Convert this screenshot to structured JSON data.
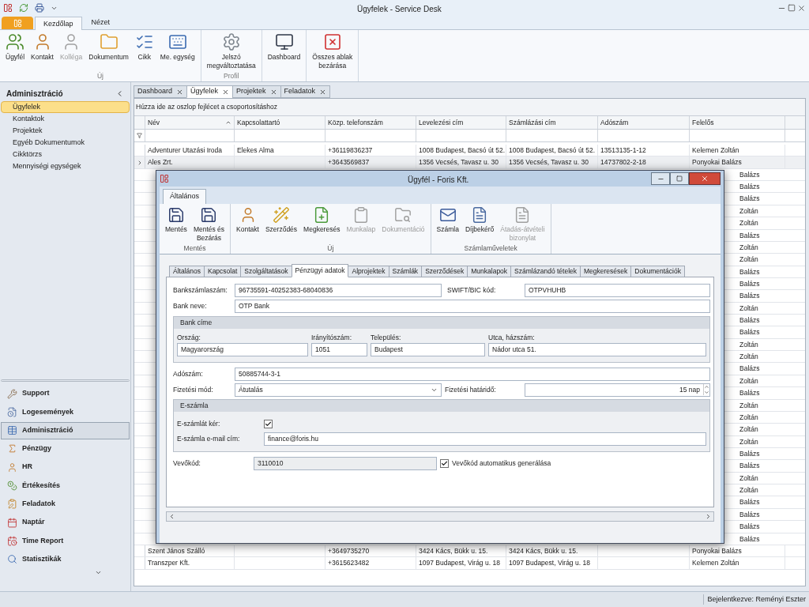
{
  "window": {
    "title": "Ügyfelek - Service Desk"
  },
  "ribbon": {
    "tabs": [
      {
        "label": "Kezdőlap",
        "selected": true
      },
      {
        "label": "Nézet",
        "selected": false
      }
    ],
    "groups": [
      {
        "label": "Új",
        "buttons": [
          {
            "label": "Ügyfél",
            "disabled": false
          },
          {
            "label": "Kontakt",
            "disabled": false
          },
          {
            "label": "Kolléga",
            "disabled": true
          },
          {
            "label": "Dokumentum",
            "disabled": false
          },
          {
            "label": "Cikk",
            "disabled": false
          },
          {
            "label": "Me. egység",
            "disabled": false
          }
        ]
      },
      {
        "label": "Profil",
        "buttons": [
          {
            "label": "Jelszó\nmegváltoztatása",
            "disabled": false
          }
        ]
      },
      {
        "buttons": [
          {
            "label": "Dashboard",
            "disabled": false
          }
        ]
      },
      {
        "buttons": [
          {
            "label": "Összes ablak\nbezárása",
            "disabled": false
          }
        ]
      }
    ]
  },
  "sidebar": {
    "title": "Adminisztráció",
    "items": [
      {
        "label": "Ügyfelek",
        "selected": true
      },
      {
        "label": "Kontaktok",
        "selected": false
      },
      {
        "label": "Projektek",
        "selected": false
      },
      {
        "label": "Egyéb Dokumentumok",
        "selected": false
      },
      {
        "label": "Cikktörzs",
        "selected": false
      },
      {
        "label": "Mennyiségi egységek",
        "selected": false
      }
    ],
    "nav": [
      {
        "label": "Support",
        "selected": false
      },
      {
        "label": "Logesemények",
        "selected": false
      },
      {
        "label": "Adminisztráció",
        "selected": true
      },
      {
        "label": "Pénzügy",
        "selected": false
      },
      {
        "label": "HR",
        "selected": false
      },
      {
        "label": "Értékesítés",
        "selected": false
      },
      {
        "label": "Feladatok",
        "selected": false
      },
      {
        "label": "Naptár",
        "selected": false
      },
      {
        "label": "Time Report",
        "selected": false
      },
      {
        "label": "Statisztikák",
        "selected": false
      }
    ]
  },
  "doc_tabs": [
    {
      "label": "Dashboard",
      "selected": false
    },
    {
      "label": "Ügyfelek",
      "selected": true
    },
    {
      "label": "Projektek",
      "selected": false
    },
    {
      "label": "Feladatok",
      "selected": false
    }
  ],
  "group_panel": "Húzza ide az oszlop fejlécet a csoportosításhoz",
  "table": {
    "columns": [
      "Név",
      "Kapcsolattartó",
      "Közp. telefonszám",
      "Levelezési cím",
      "Számlázási cím",
      "Adószám",
      "Felelős"
    ],
    "rows": [
      {
        "kind": "full",
        "current": false,
        "cells": [
          "Adventurer Utazási Iroda",
          "Elekes Alma",
          "+36119836237",
          "1008 Budapest, Bacsó út 52.",
          "1008 Budapest, Bacsó út 52.",
          "13513135-1-12",
          "Kelemen Zoltán"
        ]
      },
      {
        "kind": "full",
        "current": true,
        "cells": [
          "Ales Zrt.",
          "",
          "+3643569837",
          "1356 Vecsés, Tavasz u. 30",
          "1356 Vecsés, Tavasz u. 30",
          "14737802-2-18",
          "Ponyokai Balázs"
        ]
      },
      {
        "kind": "covered",
        "tail": "Balázs"
      },
      {
        "kind": "covered",
        "tail": "Balázs"
      },
      {
        "kind": "covered",
        "tail": "Balázs"
      },
      {
        "kind": "covered",
        "tail": "Zoltán"
      },
      {
        "kind": "covered",
        "tail": "Zoltán"
      },
      {
        "kind": "covered",
        "tail": "Balázs"
      },
      {
        "kind": "covered",
        "tail": "Zoltán"
      },
      {
        "kind": "covered",
        "tail": "Zoltán"
      },
      {
        "kind": "covered",
        "tail": "Balázs"
      },
      {
        "kind": "covered",
        "tail": "Balázs"
      },
      {
        "kind": "covered",
        "tail": "Balázs"
      },
      {
        "kind": "covered",
        "tail": "Zoltán"
      },
      {
        "kind": "covered",
        "tail": "Balázs"
      },
      {
        "kind": "covered",
        "tail": "Balázs"
      },
      {
        "kind": "covered",
        "tail": "Zoltán"
      },
      {
        "kind": "covered",
        "tail": "Zoltán"
      },
      {
        "kind": "covered",
        "tail": "Balázs"
      },
      {
        "kind": "covered",
        "tail": "Zoltán"
      },
      {
        "kind": "covered",
        "tail": "Balázs"
      },
      {
        "kind": "covered",
        "tail": "Zoltán"
      },
      {
        "kind": "covered",
        "tail": "Zoltán"
      },
      {
        "kind": "covered",
        "tail": "Zoltán"
      },
      {
        "kind": "covered",
        "tail": "Zoltán"
      },
      {
        "kind": "covered",
        "tail": "Balázs"
      },
      {
        "kind": "covered",
        "tail": "Balázs"
      },
      {
        "kind": "covered",
        "tail": "Zoltán"
      },
      {
        "kind": "covered",
        "tail": "Zoltán"
      },
      {
        "kind": "covered",
        "tail": "Balázs"
      },
      {
        "kind": "covered",
        "tail": "Balázs"
      },
      {
        "kind": "covered",
        "tail": "Balázs"
      },
      {
        "kind": "covered",
        "tail": "Balázs"
      },
      {
        "kind": "full",
        "current": false,
        "cells": [
          "Szent János Szálló",
          "",
          "+3649735270",
          "3424 Kács, Bükk u. 15.",
          "3424 Kács, Bükk u. 15.",
          "",
          "Ponyokai Balázs"
        ]
      },
      {
        "kind": "full",
        "current": false,
        "cells": [
          "Transzper Kft.",
          "",
          "+3615623482",
          "1097 Budapest, Virág u. 18",
          "1097 Budapest, Virág u. 18",
          "",
          "Kelemen Zoltán"
        ]
      }
    ]
  },
  "dialog": {
    "title": "Ügyfél - Foris Kft.",
    "ribbon_tab": "Általános",
    "groups": [
      {
        "label": "Mentés",
        "buttons": [
          {
            "label": "Mentés",
            "disabled": false
          },
          {
            "label": "Mentés és\nBezárás",
            "disabled": false
          }
        ]
      },
      {
        "label": "Új",
        "buttons": [
          {
            "label": "Kontakt",
            "disabled": false
          },
          {
            "label": "Szerződés",
            "disabled": false
          },
          {
            "label": "Megkeresés",
            "disabled": false
          },
          {
            "label": "Munkalap",
            "disabled": true
          },
          {
            "label": "Dokumentáció",
            "disabled": true
          }
        ]
      },
      {
        "label": "Számlaműveletek",
        "buttons": [
          {
            "label": "Számla",
            "disabled": false
          },
          {
            "label": "Díjbekérő",
            "disabled": false
          },
          {
            "label": "Átadás-átvételi\nbizonylat",
            "disabled": true
          }
        ]
      }
    ],
    "tabs": [
      {
        "label": "Általános",
        "selected": false
      },
      {
        "label": "Kapcsolat",
        "selected": false
      },
      {
        "label": "Szolgáltatások",
        "selected": false
      },
      {
        "label": "Pénzügyi adatok",
        "selected": true
      },
      {
        "label": "Alprojektek",
        "selected": false
      },
      {
        "label": "Számlák",
        "selected": false
      },
      {
        "label": "Szerződések",
        "selected": false
      },
      {
        "label": "Munkalapok",
        "selected": false
      },
      {
        "label": "Számlázandó tételek",
        "selected": false
      },
      {
        "label": "Megkeresések",
        "selected": false
      },
      {
        "label": "Dokumentációk",
        "selected": false
      }
    ],
    "form": {
      "bank_account": {
        "label": "Bankszámlaszám:",
        "value": "96735591-40252383-68040836"
      },
      "swift": {
        "label": "SWIFT/BIC kód:",
        "value": "OTPVHUHB"
      },
      "bank_name": {
        "label": "Bank neve:",
        "value": "OTP Bank"
      },
      "bank_address": {
        "title": "Bank címe",
        "fields": [
          {
            "label": "Ország:",
            "value": "Magyarország"
          },
          {
            "label": "Irányítószám:",
            "value": "1051"
          },
          {
            "label": "Település:",
            "value": "Budapest"
          },
          {
            "label": "Utca, házszám:",
            "value": "Nádor utca 51."
          }
        ]
      },
      "tax_number": {
        "label": "Adószám:",
        "value": "50885744-3-1"
      },
      "payment_method": {
        "label": "Fizetési mód:",
        "value": "Átutalás"
      },
      "payment_deadline": {
        "label": "Fizetési határidő:",
        "value": "15 nap"
      },
      "e_invoice": {
        "title": "E-számla",
        "request": {
          "label": "E-számlát kér:",
          "checked": true
        },
        "email": {
          "label": "E-számla e-mail cím:",
          "value": "finance@foris.hu"
        }
      },
      "customer_code": {
        "label": "Vevőkód:",
        "value": "3110010",
        "auto": {
          "label": "Vevőkód automatikus generálása",
          "checked": true
        }
      }
    }
  },
  "status_bar": "Bejelentkezve: Reményi Eszter"
}
